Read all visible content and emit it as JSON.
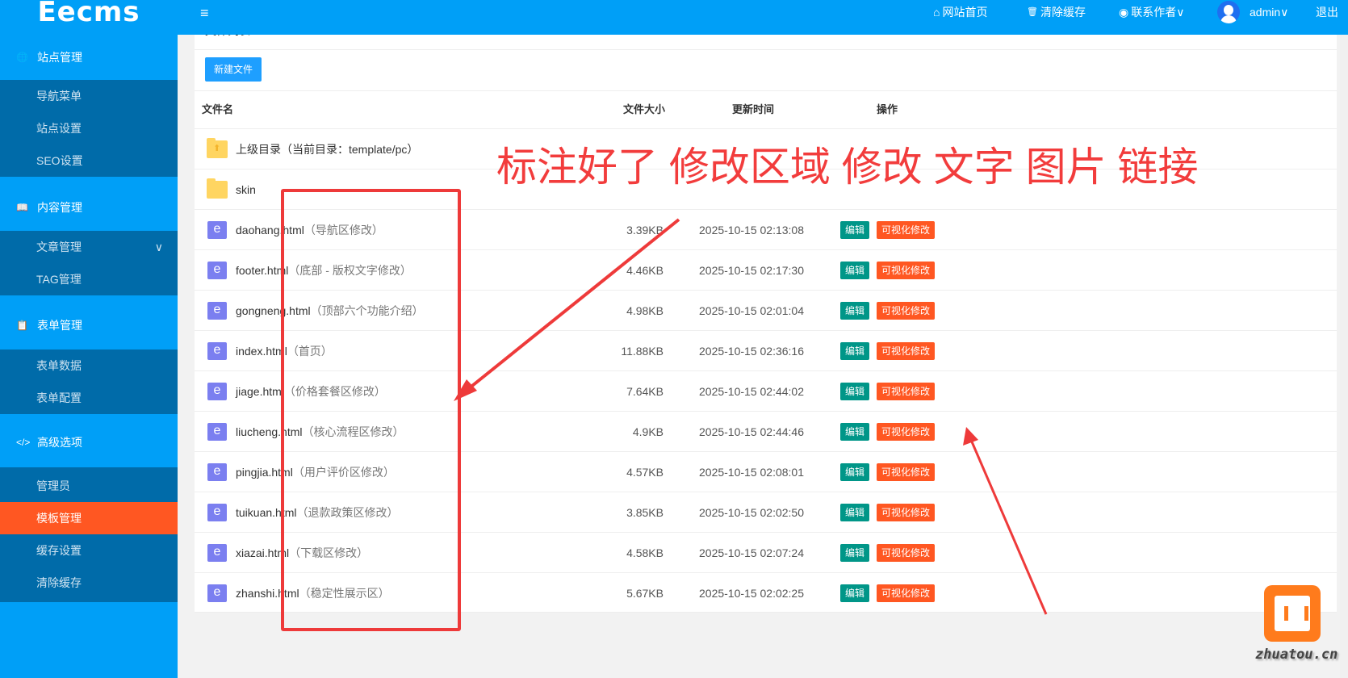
{
  "header": {
    "logo": "Eecms",
    "menu_icon": "≡",
    "nav": [
      {
        "icon": "⌂",
        "label": "网站首页"
      },
      {
        "icon": "🗑",
        "label": "清除缓存"
      },
      {
        "icon": "◉",
        "label": "联系作者∨"
      }
    ],
    "user": "admin∨",
    "logout": "退出"
  },
  "sidebar": {
    "groups": [
      {
        "icon": "🌐",
        "label": "站点管理",
        "items": [
          "导航菜单",
          "站点设置",
          "SEO设置"
        ]
      },
      {
        "icon": "📖",
        "label": "内容管理",
        "items": [
          "文章管理",
          "TAG管理"
        ]
      },
      {
        "icon": "📋",
        "label": "表单管理",
        "items": [
          "表单数据",
          "表单配置"
        ]
      },
      {
        "icon": "</>",
        "label": "高级选项",
        "items": [
          "管理员",
          "模板管理",
          "缓存设置",
          "清除缓存"
        ]
      }
    ],
    "active": "模板管理"
  },
  "main": {
    "title": "文件列表",
    "new_button": "新建文件",
    "columns": [
      "文件名",
      "文件大小",
      "更新时间",
      "操作"
    ],
    "parent": "上级目录（当前目录：template/pc）",
    "folder": "skin",
    "edit_label": "编辑",
    "visual_label": "可视化修改",
    "files": [
      {
        "name": "daohang.html",
        "desc": "（导航区修改）",
        "size": "3.39KB",
        "time": "2025-10-15 02:13:08"
      },
      {
        "name": "footer.html",
        "desc": "（底部 - 版权文字修改）",
        "size": "4.46KB",
        "time": "2025-10-15 02:17:30"
      },
      {
        "name": "gongneng.html",
        "desc": "（顶部六个功能介绍）",
        "size": "4.98KB",
        "time": "2025-10-15 02:01:04"
      },
      {
        "name": "index.html",
        "desc": "（首页）",
        "size": "11.88KB",
        "time": "2025-10-15 02:36:16"
      },
      {
        "name": "jiage.html",
        "desc": "（价格套餐区修改）",
        "size": "7.64KB",
        "time": "2025-10-15 02:44:02"
      },
      {
        "name": "liucheng.html",
        "desc": "（核心流程区修改）",
        "size": "4.9KB",
        "time": "2025-10-15 02:44:46"
      },
      {
        "name": "pingjia.html",
        "desc": "（用户评价区修改）",
        "size": "4.57KB",
        "time": "2025-10-15 02:08:01"
      },
      {
        "name": "tuikuan.html",
        "desc": "（退款政策区修改）",
        "size": "3.85KB",
        "time": "2025-10-15 02:02:50"
      },
      {
        "name": "xiazai.html",
        "desc": "（下载区修改）",
        "size": "4.58KB",
        "time": "2025-10-15 02:07:24"
      },
      {
        "name": "zhanshi.html",
        "desc": "（稳定性展示区）",
        "size": "5.67KB",
        "time": "2025-10-15 02:02:25"
      }
    ]
  },
  "annotation": "标注好了 修改区域 修改 文字 图片 链接",
  "watermark": "zhuatou.cn"
}
